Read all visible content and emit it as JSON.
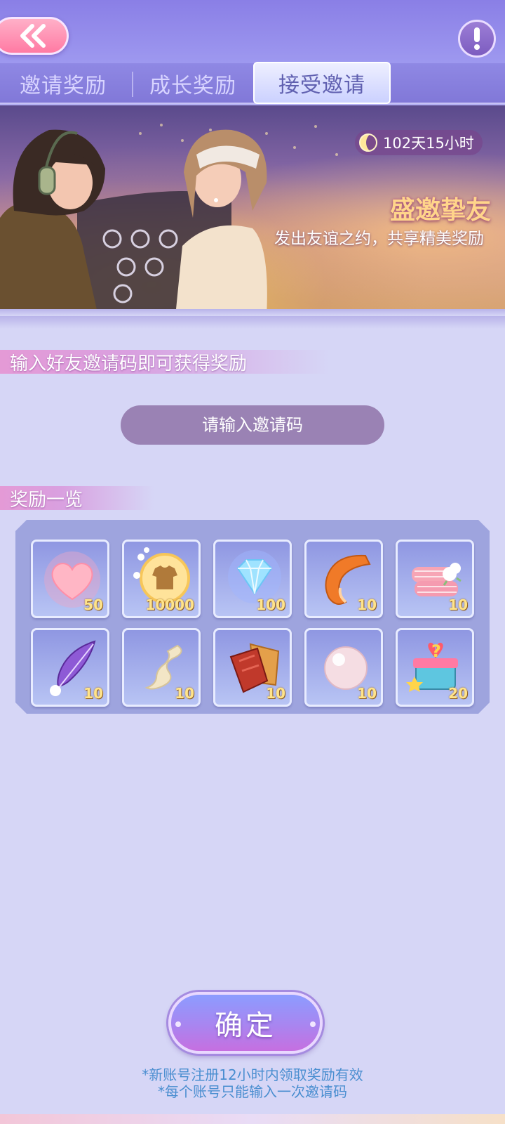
{
  "header": {
    "back_icon": "double-chevron-left-icon",
    "info_icon": "exclamation-icon"
  },
  "tabs": [
    {
      "label": "邀请奖励",
      "active": false
    },
    {
      "label": "成长奖励",
      "active": false
    },
    {
      "label": "接受邀请",
      "active": true
    }
  ],
  "banner": {
    "timer": "102天15小时",
    "title": "盛邀挚友",
    "subtitle": "发出友谊之约，共享精美奖励"
  },
  "invite": {
    "section_title": "输入好友邀请码即可获得奖励",
    "placeholder": "请输入邀请码"
  },
  "rewards": {
    "section_title": "奖励一览",
    "items": [
      {
        "icon": "heart-icon",
        "count": "50"
      },
      {
        "icon": "shirt-coin-icon",
        "count": "10000"
      },
      {
        "icon": "diamond-icon",
        "count": "100"
      },
      {
        "icon": "fox-tail-fur-icon",
        "count": "10"
      },
      {
        "icon": "fabric-roll-cotton-icon",
        "count": "10"
      },
      {
        "icon": "feather-icon",
        "count": "10"
      },
      {
        "icon": "silk-ribbon-icon",
        "count": "10"
      },
      {
        "icon": "leather-icon",
        "count": "10"
      },
      {
        "icon": "pearl-icon",
        "count": "10"
      },
      {
        "icon": "mystery-gift-box-icon",
        "count": "20"
      }
    ]
  },
  "confirm": {
    "label": "确定"
  },
  "notes": [
    "*新账号注册12小时内领取奖励有效",
    "*每个账号只能输入一次邀请码"
  ],
  "colors": {
    "page_bg": "#d6d6f6",
    "tab_bar": "#8178d8",
    "count_text": "#ffe48a",
    "note_text": "#4a8ed0",
    "back_button": "#ff7aa3"
  }
}
